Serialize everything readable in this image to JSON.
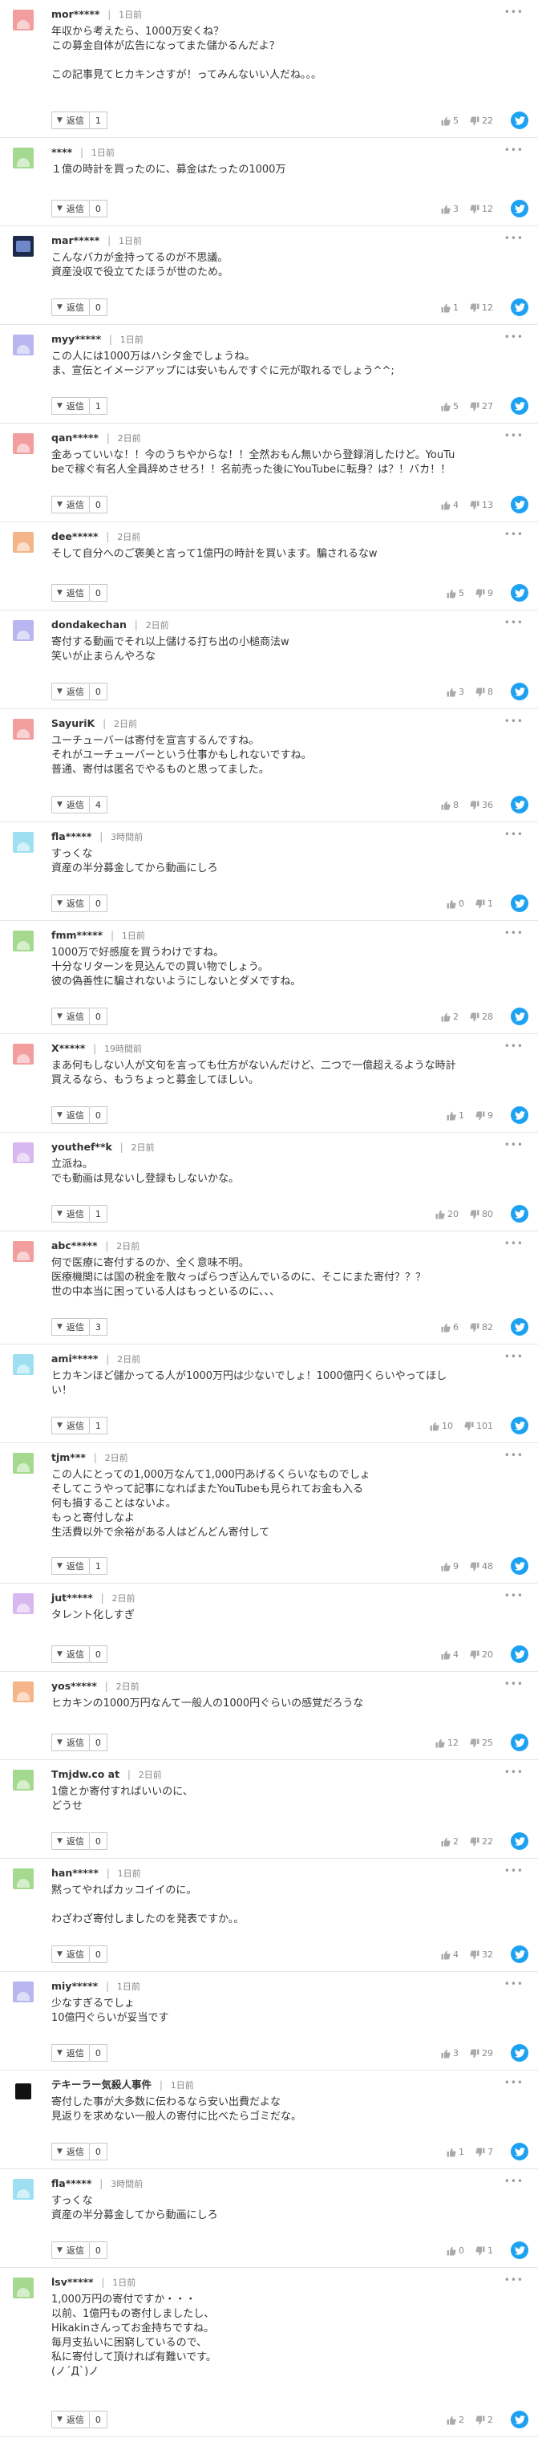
{
  "ui": {
    "reply_label": "返信",
    "more_glyph": "•••",
    "separator": "|"
  },
  "comments": [
    {
      "user": "mor*****",
      "time": "1日前",
      "avatar_color": "#f29e9e",
      "lines": [
        "年収から考えたら、1000万安くね？",
        "この募金自体が広告になってまた儲かるんだよ？",
        "",
        "この記事見てヒカキンさすが！ってみんないい人だね。。。"
      ],
      "replies": "1",
      "likes": "5",
      "dislikes": "22"
    },
    {
      "user": "****",
      "time": "1日前",
      "avatar_color": "#a4d98f",
      "lines": [
        "１億の時計を買ったのに、募金はたったの1000万"
      ],
      "replies": "0",
      "likes": "3",
      "dislikes": "12"
    },
    {
      "user": "mar*****",
      "time": "1日前",
      "avatar_color": "dark",
      "lines": [
        "こんなバカが金持ってるのが不思議。",
        "資産没収で役立てたほうが世のため。"
      ],
      "replies": "0",
      "likes": "1",
      "dislikes": "12"
    },
    {
      "user": "myy*****",
      "time": "1日前",
      "avatar_color": "#b8b6f0",
      "lines": [
        "この人には1000万はハシタ金でしょうね。",
        "ま、宣伝とイメージアップには安いもんですぐに元が取れるでしょう^^;"
      ],
      "replies": "1",
      "likes": "5",
      "dislikes": "27"
    },
    {
      "user": "qan*****",
      "time": "2日前",
      "avatar_color": "#f29e9e",
      "lines": [
        "金あっていいな！！今のうちやからな！！全然おもん無いから登録消したけど。YouTu",
        "beで稼ぐ有名人全員辞めさせろ！！名前売った後にYouTubeに転身？は？！バカ！！"
      ],
      "replies": "0",
      "likes": "4",
      "dislikes": "13"
    },
    {
      "user": "dee*****",
      "time": "2日前",
      "avatar_color": "#f5b48a",
      "lines": [
        "そして自分へのご褒美と言って1億円の時計を買います。騙されるなw"
      ],
      "replies": "0",
      "likes": "5",
      "dislikes": "9"
    },
    {
      "user": "dondakechan",
      "time": "2日前",
      "avatar_color": "#b8b6f0",
      "lines": [
        "寄付する動画でそれ以上儲ける打ち出の小槌商法w",
        "笑いが止まらんやろな"
      ],
      "replies": "0",
      "likes": "3",
      "dislikes": "8"
    },
    {
      "user": "SayuriK",
      "time": "2日前",
      "avatar_color": "#f29e9e",
      "lines": [
        "ユーチューバーは寄付を宣言するんですね。",
        "それがユーチューバーという仕事かもしれないですね。",
        "普通、寄付は匿名でやるものと思ってました。"
      ],
      "replies": "4",
      "likes": "8",
      "dislikes": "36"
    },
    {
      "user": "fla*****",
      "time": "3時間前",
      "avatar_color": "#9edff2",
      "lines": [
        "すっくな",
        "資産の半分募金してから動画にしろ"
      ],
      "replies": "0",
      "likes": "0",
      "dislikes": "1"
    },
    {
      "user": "fmm*****",
      "time": "1日前",
      "avatar_color": "#a4d98f",
      "lines": [
        "1000万で好感度を買うわけですね。",
        "十分なリターンを見込んでの買い物でしょう。",
        "彼の偽善性に騙されないようにしないとダメですね。"
      ],
      "replies": "0",
      "likes": "2",
      "dislikes": "28"
    },
    {
      "user": "X*****",
      "time": "19時間前",
      "avatar_color": "#f29e9e",
      "lines": [
        "まあ何もしない人が文句を言っても仕方がないんだけど、二つで一億超えるような時計",
        "買えるなら、もうちょっと募金してほしい。"
      ],
      "replies": "0",
      "likes": "1",
      "dislikes": "9"
    },
    {
      "user": "youthef**k",
      "time": "2日前",
      "avatar_color": "#d9b8f0",
      "lines": [
        "立派ね。",
        "でも動画は見ないし登録もしないかな。"
      ],
      "replies": "1",
      "likes": "20",
      "dislikes": "80"
    },
    {
      "user": "abc*****",
      "time": "2日前",
      "avatar_color": "#f29e9e",
      "lines": [
        "何で医療に寄付するのか、全く意味不明。",
        "医療機関には国の税金を散々っぱらつぎ込んでいるのに、そこにまた寄付？？？",
        "世の中本当に困っている人はもっといるのに、、、"
      ],
      "replies": "3",
      "likes": "6",
      "dislikes": "82"
    },
    {
      "user": "ami*****",
      "time": "2日前",
      "avatar_color": "#9edff2",
      "lines": [
        "ヒカキンほど儲かってる人が1000万円は少ないでしょ！1000億円くらいやってほし",
        "い！"
      ],
      "replies": "1",
      "likes": "10",
      "dislikes": "101"
    },
    {
      "user": "tjm***",
      "time": "2日前",
      "avatar_color": "#a4d98f",
      "lines": [
        "この人にとっての1,000万なんて1,000円あげるくらいなものでしょ",
        "そしてこうやって記事になればまたYouTubeも見られてお金も入る",
        "何も損することはないよ。",
        "もっと寄付しなよ",
        "生活費以外で余裕がある人はどんどん寄付して"
      ],
      "replies": "1",
      "likes": "9",
      "dislikes": "48"
    },
    {
      "user": "jut*****",
      "time": "2日前",
      "avatar_color": "#d9b8f0",
      "lines": [
        "タレント化しすぎ"
      ],
      "replies": "0",
      "likes": "4",
      "dislikes": "20"
    },
    {
      "user": "yos*****",
      "time": "2日前",
      "avatar_color": "#f5b48a",
      "lines": [
        "ヒカキンの1000万円なんて一般人の1000円ぐらいの感覚だろうな"
      ],
      "replies": "0",
      "likes": "12",
      "dislikes": "25"
    },
    {
      "user": "Tmjdw.co at",
      "time": "2日前",
      "avatar_color": "#a4d98f",
      "lines": [
        "1億とか寄付すればいいのに、",
        "どうせ"
      ],
      "replies": "0",
      "likes": "2",
      "dislikes": "22"
    },
    {
      "user": "han*****",
      "time": "1日前",
      "avatar_color": "#a4d98f",
      "lines": [
        "黙ってやればカッコイイのに。",
        "",
        "わざわざ寄付しましたのを発表ですか。。"
      ],
      "replies": "0",
      "likes": "4",
      "dislikes": "32"
    },
    {
      "user": "miy*****",
      "time": "1日前",
      "avatar_color": "#b8b6f0",
      "lines": [
        "少なすぎるでしょ",
        "10億円ぐらいが妥当です"
      ],
      "replies": "0",
      "likes": "3",
      "dislikes": "29"
    },
    {
      "user": "テキーラー気殺人事件",
      "time": "1日前",
      "avatar_color": "small",
      "lines": [
        "寄付した事が大多数に伝わるなら安い出費だよな",
        "見返りを求めない一般人の寄付に比べたらゴミだな。"
      ],
      "replies": "0",
      "likes": "1",
      "dislikes": "7"
    },
    {
      "user": "fla*****",
      "time": "3時間前",
      "avatar_color": "#9edff2",
      "lines": [
        "すっくな",
        "資産の半分募金してから動画にしろ"
      ],
      "replies": "0",
      "likes": "0",
      "dislikes": "1"
    },
    {
      "user": "lsv*****",
      "time": "1日前",
      "avatar_color": "#a4d98f",
      "lines": [
        "1,000万円の寄付ですか・・・",
        "以前、1億円もの寄付しましたし、",
        "Hikakinさんってお金持ちですね。",
        "毎月支払いに困窮しているので、",
        "私に寄付して頂ければ有難いです。",
        "(ノ´Д`)ノ"
      ],
      "replies": "0",
      "likes": "2",
      "dislikes": "2"
    }
  ]
}
